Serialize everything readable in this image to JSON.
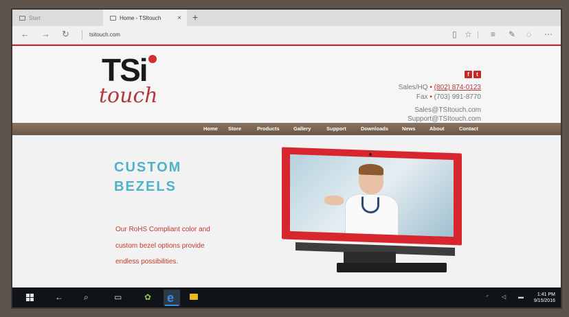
{
  "browser": {
    "tabs": [
      {
        "label": "Start",
        "active": false
      },
      {
        "label": "Home - TSItouch",
        "active": true
      }
    ],
    "new_tab_icon": "+",
    "close_tab_icon": "×",
    "address": "tsitouch.com"
  },
  "site": {
    "logo": {
      "main": "TSi",
      "sub": "touch"
    },
    "social": [
      {
        "name": "facebook-icon",
        "glyph": "f"
      },
      {
        "name": "twitter-icon",
        "glyph": "t"
      }
    ],
    "contact": {
      "sales_label": "Sales/HQ",
      "sales_phone": "(802) 874-0123",
      "fax_label": "Fax",
      "fax_phone": "(703) 991-8770",
      "sep": "•",
      "email_sales": "Sales@TSItouch.com",
      "email_support": "Support@TSItouch.com"
    },
    "nav": [
      "Home",
      "Store",
      "Products",
      "Gallery",
      "Support",
      "Downloads",
      "News",
      "About",
      "Contact"
    ],
    "hero": {
      "title_line1": "CUSTOM",
      "title_line2": "BEZELS",
      "text_line1": "Our RoHS Compliant color and",
      "text_line2": "custom bezel options provide",
      "text_line3": "endless possibilities."
    }
  },
  "taskbar": {
    "time": "1:41 PM",
    "date": "9/15/2016"
  },
  "colors": {
    "brand_red": "#c7262e",
    "hero_title": "#4fb3c7",
    "nav_brown": "#7a6655"
  }
}
